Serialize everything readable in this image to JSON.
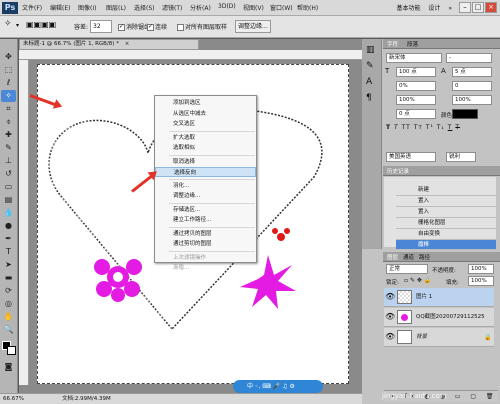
{
  "app": {
    "logo": "Ps"
  },
  "menubar": [
    "文件(F)",
    "编辑(E)",
    "图像(I)",
    "图层(L)",
    "选择(S)",
    "滤镜(T)",
    "分析(A)",
    "3D(D)",
    "视图(V)",
    "窗口(W)",
    "帮助(H)"
  ],
  "topbar": {
    "zoom": "66.7",
    "workspace_basic": "基本功能",
    "workspace_design": "设计",
    "more": "»"
  },
  "options": {
    "feather_label": "容差:",
    "feather_value": "32",
    "anti_alias": "消除锯齿",
    "contiguous": "连续",
    "all_layers": "对所有图层取样",
    "refine_edge": "调整边缘..."
  },
  "document": {
    "tab": "未标题-1 @ 66.7% (图片 1, RGB/8) *",
    "close": "×"
  },
  "context_menu": {
    "items": [
      {
        "label": "添加到选区",
        "state": "normal"
      },
      {
        "label": "从选区中减去",
        "state": "normal"
      },
      {
        "label": "交叉选区",
        "state": "normal"
      },
      {
        "label": "扩大选取",
        "state": "normal"
      },
      {
        "label": "选取相似",
        "state": "normal"
      },
      {
        "label": "取消选择",
        "state": "normal"
      },
      {
        "label": "选择反向",
        "state": "highlighted"
      },
      {
        "label": "羽化...",
        "state": "normal"
      },
      {
        "label": "调整边缘...",
        "state": "normal"
      },
      {
        "label": "存储选区...",
        "state": "normal"
      },
      {
        "label": "建立工作路径...",
        "state": "normal"
      },
      {
        "label": "通过拷贝的图层",
        "state": "normal"
      },
      {
        "label": "通过剪切的图层",
        "state": "normal"
      },
      {
        "label": "上次滤镜操作",
        "state": "disabled"
      },
      {
        "label": "渐隐...",
        "state": "disabled"
      }
    ]
  },
  "statusbar": {
    "zoom": "66.67%",
    "doc_info": "文档:2.99M/4.39M"
  },
  "watermark": {
    "text": "jingyan.baidu.com",
    "bar_text": "中 ◦, ⌨ 🎤 ♫ ⚙"
  },
  "char_panel": {
    "tabs": [
      "字符",
      "段落"
    ],
    "font": "新宋体",
    "style": "-",
    "size": "100 点",
    "leading": "5 点",
    "tracking": "0%",
    "kerning": "0",
    "scale_v": "100%",
    "scale_h": "100%",
    "baseline": "0 点",
    "color_label": "颜色:",
    "language": "美国英语",
    "aa": "锐利"
  },
  "history": {
    "tab": "历史记录",
    "items": [
      "新建",
      "置入",
      "置入",
      "栅格化图层",
      "自由变换",
      "魔棒"
    ],
    "selected_index": 5
  },
  "layers": {
    "tabs": [
      "图层",
      "通道",
      "路径"
    ],
    "blend_mode": "正常",
    "opacity_label": "不透明度:",
    "opacity": "100%",
    "lock_label": "锁定:",
    "fill_label": "填充:",
    "fill": "100%",
    "items": [
      {
        "name": "图片 1",
        "selected": true
      },
      {
        "name": "QQ截图20200729112525",
        "selected": false
      },
      {
        "name": "背景",
        "selected": false
      }
    ]
  },
  "colors": {
    "accent": "#4a86d3",
    "magenta": "#e31be3",
    "red": "#e33228",
    "selection_bg": "#cfe3f7"
  }
}
